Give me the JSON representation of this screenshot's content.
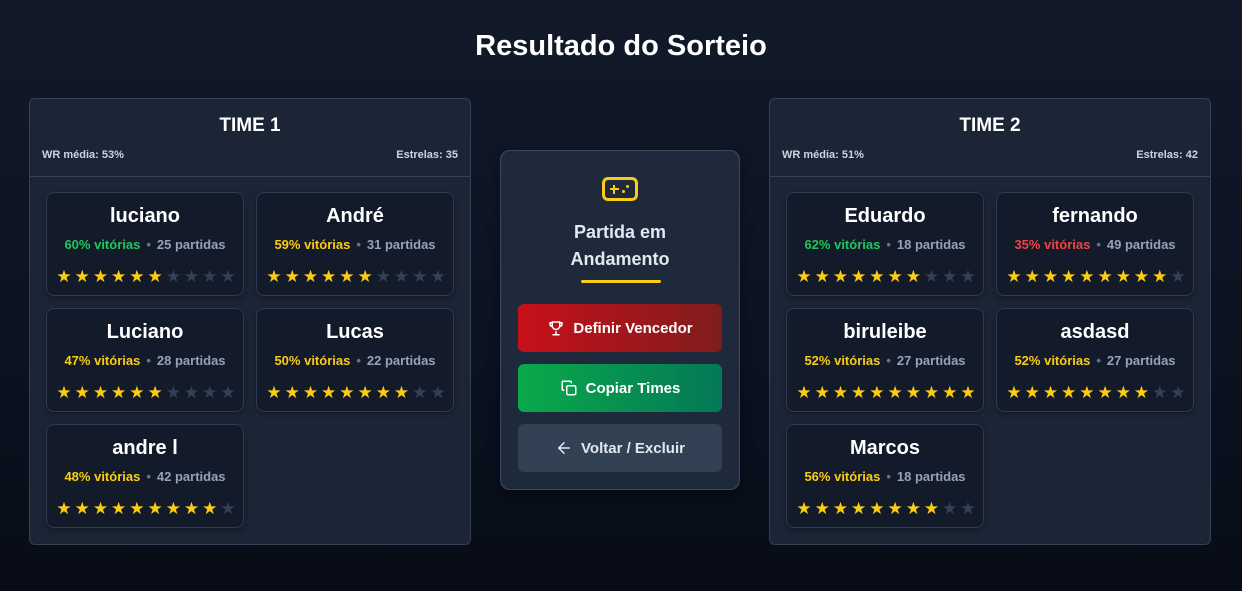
{
  "page_title": "Resultado do Sorteio",
  "teams": [
    {
      "name": "TIME 1",
      "wr_label": "WR média: 53%",
      "stars_label": "Estrelas: 35",
      "players": [
        {
          "name": "luciano",
          "winrate": "60% vitórias",
          "wr_color": "green",
          "games": "25 partidas",
          "stars": 6
        },
        {
          "name": "André",
          "winrate": "59% vitórias",
          "wr_color": "yellow",
          "games": "31 partidas",
          "stars": 6
        },
        {
          "name": "Luciano",
          "winrate": "47% vitórias",
          "wr_color": "yellow",
          "games": "28 partidas",
          "stars": 6
        },
        {
          "name": "Lucas",
          "winrate": "50% vitórias",
          "wr_color": "yellow",
          "games": "22 partidas",
          "stars": 8
        },
        {
          "name": "andre l",
          "winrate": "48% vitórias",
          "wr_color": "yellow",
          "games": "42 partidas",
          "stars": 9
        }
      ]
    },
    {
      "name": "TIME 2",
      "wr_label": "WR média: 51%",
      "stars_label": "Estrelas: 42",
      "players": [
        {
          "name": "Eduardo",
          "winrate": "62% vitórias",
          "wr_color": "green",
          "games": "18 partidas",
          "stars": 7
        },
        {
          "name": "fernando",
          "winrate": "35% vitórias",
          "wr_color": "red",
          "games": "49 partidas",
          "stars": 9
        },
        {
          "name": "biruleibe",
          "winrate": "52% vitórias",
          "wr_color": "yellow",
          "games": "27 partidas",
          "stars": 10
        },
        {
          "name": "asdasd",
          "winrate": "52% vitórias",
          "wr_color": "yellow",
          "games": "27 partidas",
          "stars": 8
        },
        {
          "name": "Marcos",
          "winrate": "56% vitórias",
          "wr_color": "yellow",
          "games": "18 partidas",
          "stars": 8
        }
      ]
    }
  ],
  "max_stars": 10,
  "match": {
    "icon": "gamepad-icon",
    "status": "Partida em Andamento",
    "buttons": {
      "winner": {
        "label": "Definir Vencedor",
        "icon": "trophy-icon"
      },
      "copy": {
        "label": "Copiar Times",
        "icon": "copy-icon"
      },
      "back": {
        "label": "Voltar / Excluir",
        "icon": "arrow-left-icon"
      }
    }
  },
  "colors": {
    "accent": "#facc15",
    "win_green": "#22c55e",
    "win_red": "#ef4444",
    "danger_button": "#c8101a",
    "success_button": "#0aa94a"
  }
}
